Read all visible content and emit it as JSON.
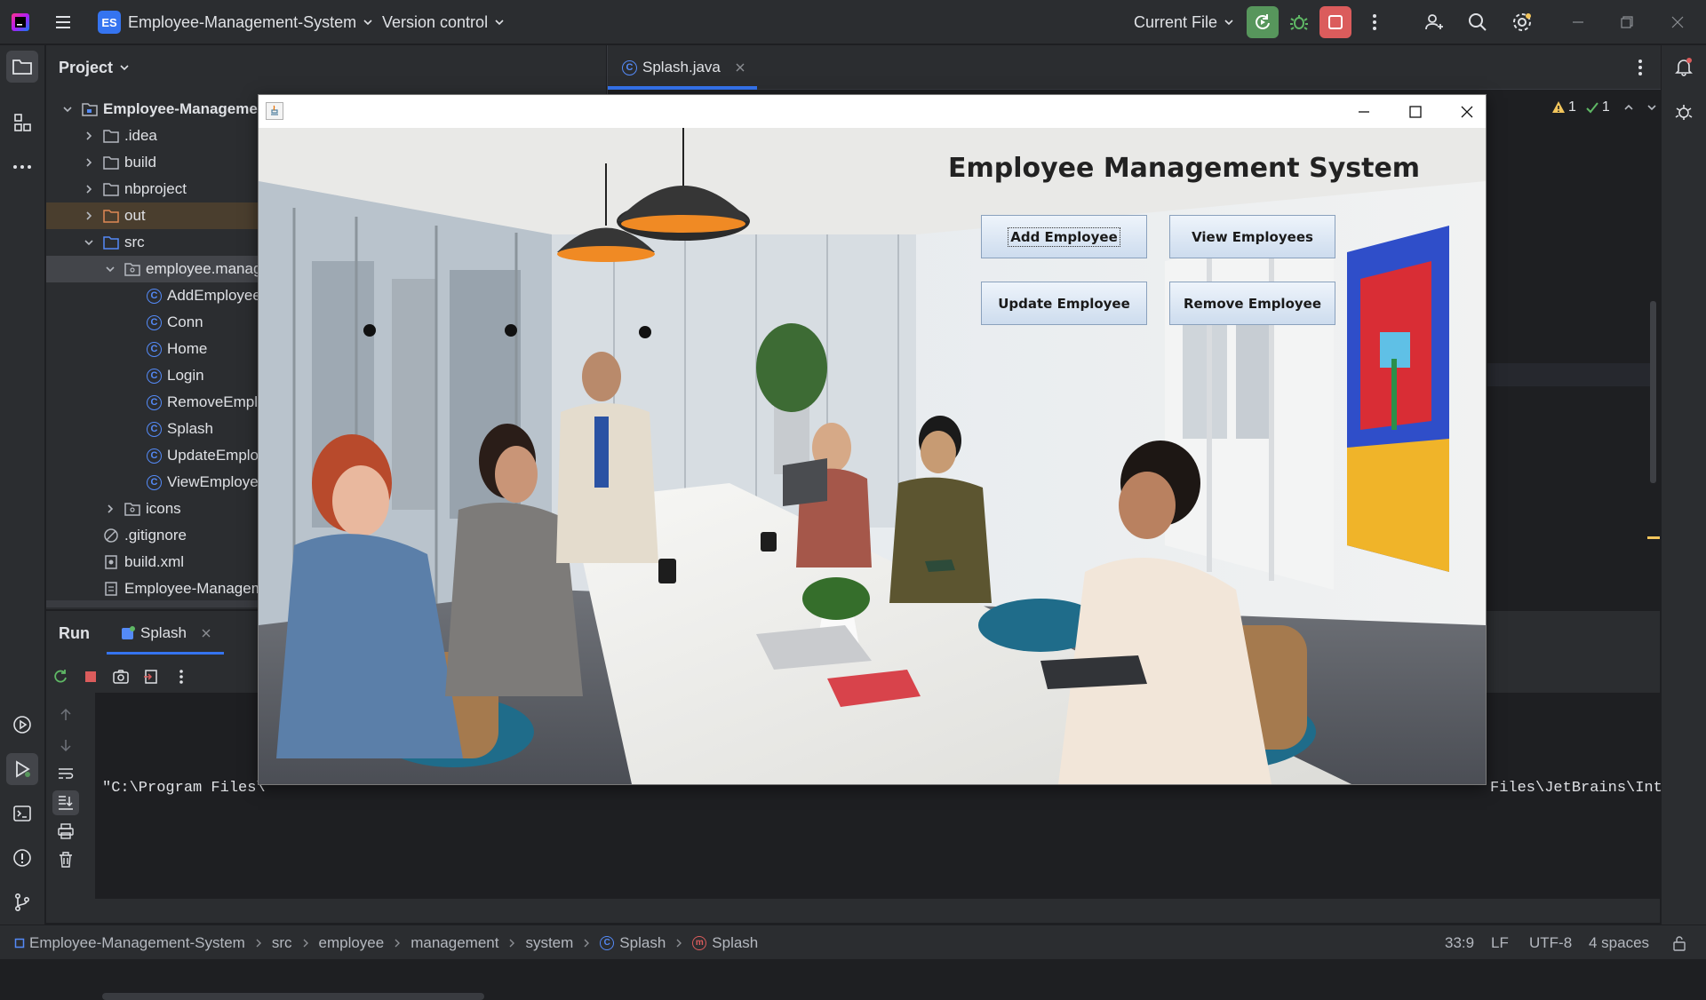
{
  "titlebar": {
    "project_badge": "ES",
    "project_name": "Employee-Management-System",
    "version_control": "Version control",
    "run_config": "Current File"
  },
  "project_panel": {
    "title": "Project",
    "tree": [
      {
        "label": "Employee-Management-System",
        "kind": "module"
      },
      {
        "label": ".idea",
        "kind": "folder"
      },
      {
        "label": "build",
        "kind": "folder"
      },
      {
        "label": "nbproject",
        "kind": "folder"
      },
      {
        "label": "out",
        "kind": "folder"
      },
      {
        "label": "src",
        "kind": "folder"
      },
      {
        "label": "employee.management.system",
        "kind": "package"
      },
      {
        "label": "AddEmployee",
        "kind": "class"
      },
      {
        "label": "Conn",
        "kind": "class"
      },
      {
        "label": "Home",
        "kind": "class"
      },
      {
        "label": "Login",
        "kind": "class"
      },
      {
        "label": "RemoveEmployee",
        "kind": "class"
      },
      {
        "label": "Splash",
        "kind": "class"
      },
      {
        "label": "UpdateEmployee",
        "kind": "class"
      },
      {
        "label": "ViewEmployee",
        "kind": "class"
      },
      {
        "label": "icons",
        "kind": "package"
      },
      {
        "label": ".gitignore",
        "kind": "file"
      },
      {
        "label": "build.xml",
        "kind": "file"
      },
      {
        "label": "Employee-Management-System.iml",
        "kind": "file"
      }
    ]
  },
  "editor": {
    "tab_label": "Splash.java",
    "warnings": "1",
    "checks": "1"
  },
  "run_panel": {
    "title": "Run",
    "tab_label": "Splash",
    "console_left": "\"C:\\Program Files\\",
    "console_right": "Files\\JetBrains\\Int"
  },
  "statusbar": {
    "crumbs": [
      "Employee-Management-System",
      "src",
      "employee",
      "management",
      "system",
      "Splash",
      "Splash"
    ],
    "position": "33:9",
    "line_sep": "LF",
    "encoding": "UTF-8",
    "indent": "4 spaces"
  },
  "app_window": {
    "heading": "Employee Management System",
    "buttons": {
      "add": "Add Employee",
      "view": "View Employees",
      "update": "Update Employee",
      "remove": "Remove Employee"
    }
  },
  "colors": {
    "accent": "#3574f0",
    "run_green": "#57965c",
    "stop_red": "#db5c5c",
    "warning": "#f2c55c"
  }
}
